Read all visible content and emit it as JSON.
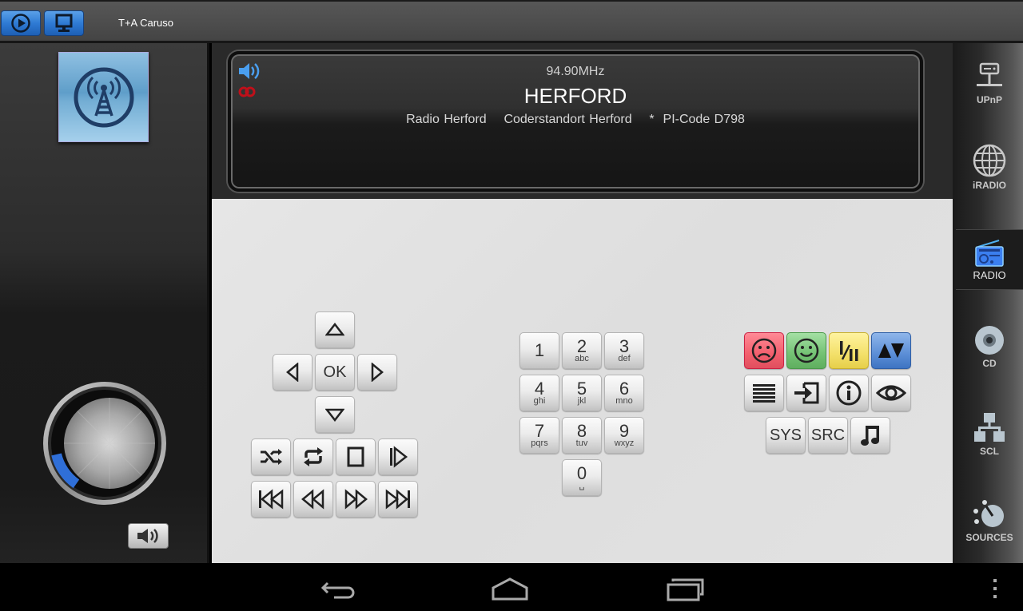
{
  "topbar": {
    "play_button_icon": "play-circle-icon",
    "screen_button_icon": "monitor-icon",
    "title": "T+A Caruso"
  },
  "left_panel": {
    "source_art_icon": "radio-tower-icon",
    "volume_level_fraction": 0.14,
    "mute_button_icon": "speaker-icon"
  },
  "display": {
    "frequency": "94.90MHz",
    "station": "HERFORD",
    "rds_text": "Radio Herford    Coderstandort Herford    *  PI-Code D798",
    "speaker_indicator_icon": "speaker-icon",
    "stereo_indicator_icon": "stereo-icon",
    "colors": {
      "speaker": "#4a9ff0",
      "stereo": "#c0101a"
    }
  },
  "dpad": {
    "up": "up-arrow-icon",
    "left": "left-arrow-icon",
    "ok_label": "OK",
    "right": "right-arrow-icon",
    "down": "down-arrow-icon"
  },
  "transport": {
    "row1": [
      "shuffle-icon",
      "repeat-icon",
      "stop-icon",
      "play-pause-icon"
    ],
    "row2": [
      "skip-back-icon",
      "rewind-icon",
      "fast-forward-icon",
      "skip-forward-icon"
    ]
  },
  "keypad": {
    "keys": [
      {
        "num": "1",
        "sub": ""
      },
      {
        "num": "2",
        "sub": "abc"
      },
      {
        "num": "3",
        "sub": "def"
      },
      {
        "num": "4",
        "sub": "ghi"
      },
      {
        "num": "5",
        "sub": "jkl"
      },
      {
        "num": "6",
        "sub": "mno"
      },
      {
        "num": "7",
        "sub": "pqrs"
      },
      {
        "num": "8",
        "sub": "tuv"
      },
      {
        "num": "9",
        "sub": "wxyz"
      },
      {
        "num": "0",
        "sub": "␣"
      }
    ]
  },
  "function_keys": {
    "row1": [
      {
        "icon": "sad-face-icon",
        "color": "#f25f6d"
      },
      {
        "icon": "happy-face-icon",
        "color": "#73c173"
      },
      {
        "icon": "mono-stereo-icon",
        "color": "#f3e06a"
      },
      {
        "icon": "up-down-icon",
        "color": "#5b8ed6"
      }
    ],
    "row2": [
      "list-icon",
      "input-icon",
      "info-icon",
      "eye-icon"
    ],
    "sys_label": "SYS",
    "src_label": "SRC",
    "music_icon": "music-note-icon"
  },
  "sidebar": {
    "items": [
      {
        "label": "UPnP",
        "icon": "upnp-icon",
        "active": false
      },
      {
        "label": "iRADIO",
        "icon": "globe-icon",
        "active": false
      },
      {
        "label": "RADIO",
        "icon": "radio-icon",
        "active": true
      },
      {
        "label": "CD",
        "icon": "cd-icon",
        "active": false
      },
      {
        "label": "SCL",
        "icon": "network-icon",
        "active": false
      },
      {
        "label": "SOURCES",
        "icon": "sources-knob-icon",
        "active": false
      }
    ]
  },
  "navbar": {
    "back": "back-icon",
    "home": "home-icon",
    "recents": "recents-icon",
    "menu": "overflow-menu-icon"
  }
}
